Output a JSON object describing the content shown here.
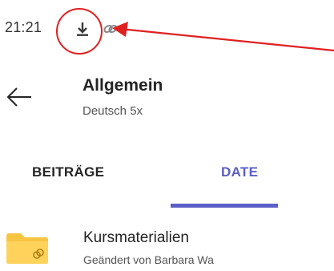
{
  "status_bar": {
    "time": "21:21",
    "icons": [
      "download-icon",
      "link-icon"
    ]
  },
  "header": {
    "back_icon": "arrow-left-icon",
    "title": "Allgemein",
    "subtitle": "Deutsch 5x"
  },
  "tabs": [
    {
      "label": "BEITRÄGE",
      "selected": false
    },
    {
      "label": "DATE",
      "selected": true
    }
  ],
  "files": [
    {
      "icon": "folder-icon",
      "name": "Kursmaterialien",
      "meta": "Geändert von Barbara Wa"
    }
  ],
  "colors": {
    "accent": "#5b5fc7",
    "annotation": "#e02020",
    "folder": "#f7c542"
  }
}
